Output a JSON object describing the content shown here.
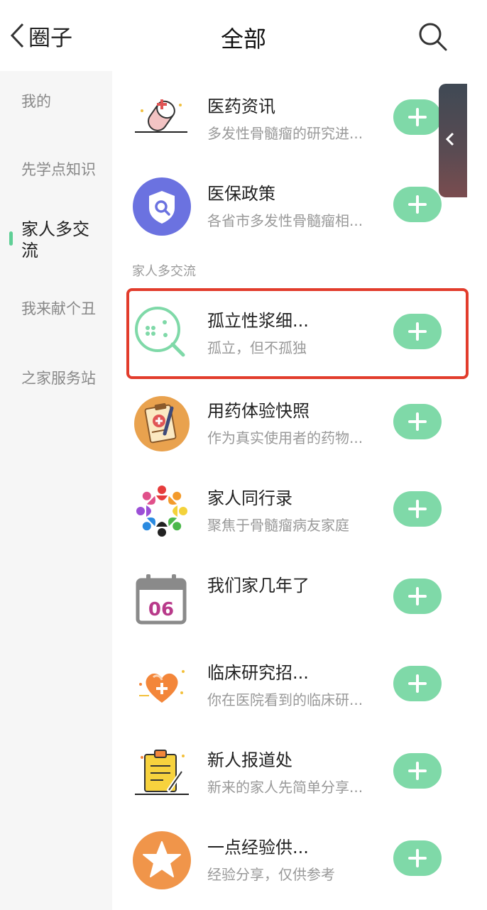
{
  "header": {
    "back_label": "圈子",
    "title": "全部"
  },
  "sidebar": {
    "items": [
      {
        "label": "我的"
      },
      {
        "label": "先学点知识"
      },
      {
        "label": "家人多交\n流",
        "active": true
      },
      {
        "label": "我来献个丑"
      },
      {
        "label": "之家服务站"
      }
    ]
  },
  "section_label": "家人多交流",
  "list": [
    {
      "name": "医药资讯",
      "desc": "多发性骨髓瘤的研究进...",
      "icon": "pill-capsule-icon"
    },
    {
      "name": "医保政策",
      "desc": "各省市多发性骨髓瘤相...",
      "icon": "shield-search-icon"
    },
    {
      "name": "孤立性浆细...",
      "desc": "孤立，但不孤独",
      "icon": "magnifier-cells-icon"
    },
    {
      "name": "用药体验快照",
      "desc": "作为真实使用者的药物...",
      "icon": "medical-clipboard-icon"
    },
    {
      "name": "家人同行录",
      "desc": "聚焦于骨髓瘤病友家庭",
      "icon": "people-circle-icon"
    },
    {
      "name": "我们家几年了",
      "desc": "",
      "icon": "calendar-icon",
      "calendar_day": "06"
    },
    {
      "name": "临床研究招...",
      "desc": "你在医院看到的临床研...",
      "icon": "heart-plus-icon"
    },
    {
      "name": "新人报道处",
      "desc": "新来的家人先简单分享...",
      "icon": "notepad-pencil-icon"
    },
    {
      "name": "一点经验供...",
      "desc": "经验分享，仅供参考",
      "icon": "star-icon"
    }
  ],
  "colors": {
    "accent": "#7fd9a8",
    "highlight_border": "#e23c2c",
    "sidebar_bg": "#f6f6f6"
  }
}
